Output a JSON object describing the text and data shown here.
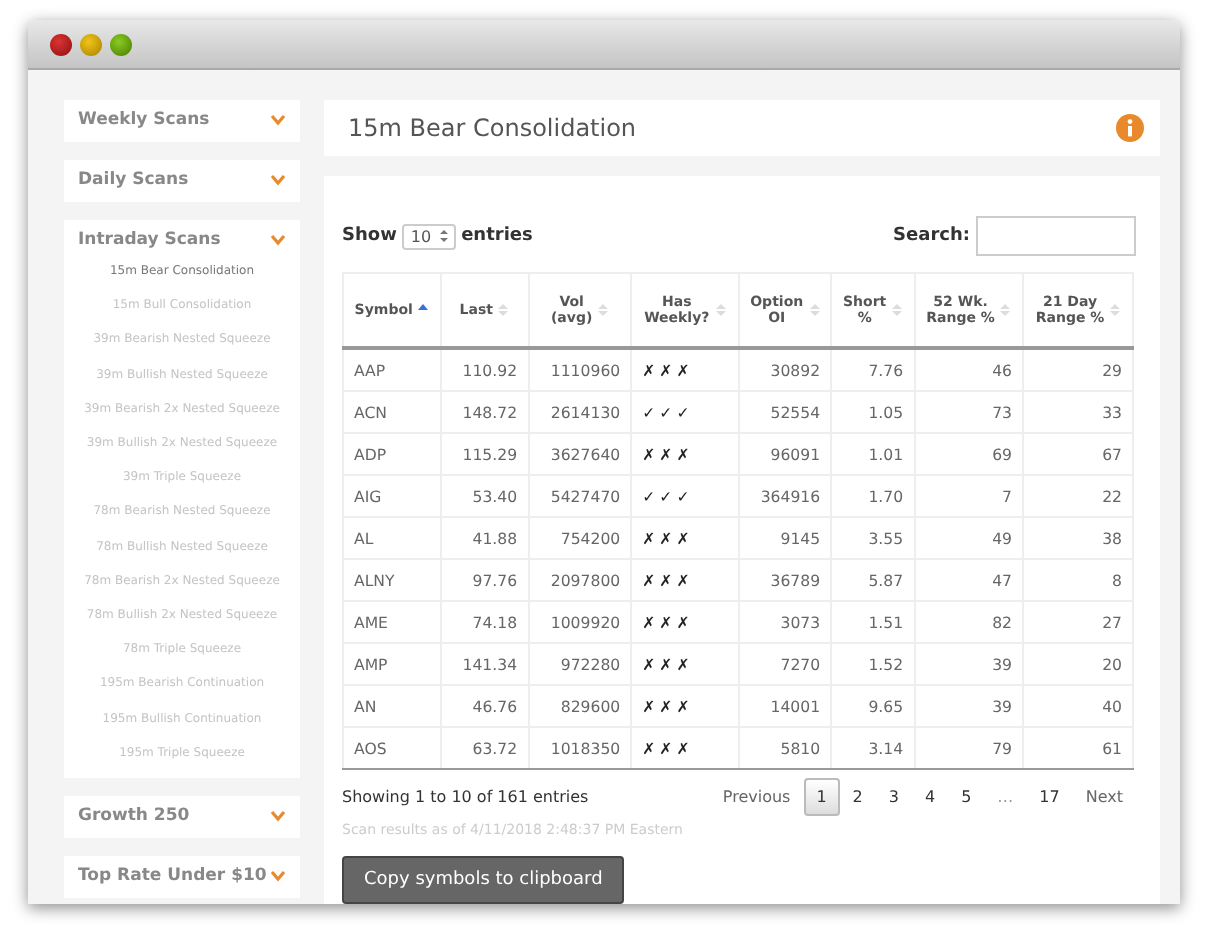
{
  "sidebar": [
    {
      "title": "Weekly Scans"
    },
    {
      "title": "Daily Scans"
    },
    {
      "title": "Intraday Scans",
      "items": [
        {
          "label": "15m Bear Consolidation",
          "selected": true
        },
        {
          "label": "15m Bull Consolidation",
          "selected": false
        },
        {
          "label": "39m Bearish Nested Squeeze",
          "selected": false
        },
        {
          "label": "39m Bullish Nested Squeeze",
          "selected": false
        },
        {
          "label": "39m Bearish 2x Nested Squeeze",
          "selected": false
        },
        {
          "label": "39m Bullish 2x Nested Squeeze",
          "selected": false
        },
        {
          "label": "39m Triple Squeeze",
          "selected": false
        },
        {
          "label": "78m Bearish Nested Squeeze",
          "selected": false
        },
        {
          "label": "78m Bullish Nested Squeeze",
          "selected": false
        },
        {
          "label": "78m Bearish 2x Nested Squeeze",
          "selected": false
        },
        {
          "label": "78m Bullish 2x Nested Squeeze",
          "selected": false
        },
        {
          "label": "78m Triple Squeeze",
          "selected": false
        },
        {
          "label": "195m Bearish Continuation",
          "selected": false
        },
        {
          "label": "195m Bullish Continuation",
          "selected": false
        },
        {
          "label": "195m Triple Squeeze",
          "selected": false
        }
      ]
    },
    {
      "title": "Growth 250"
    },
    {
      "title": "Top Rate Under $10"
    }
  ],
  "header": {
    "title": "15m Bear Consolidation"
  },
  "length_control": {
    "before": "Show",
    "value": "10",
    "after": "entries"
  },
  "search": {
    "label": "Search:"
  },
  "table": {
    "columns": [
      {
        "lines": [
          "Symbol"
        ],
        "sorted": true
      },
      {
        "lines": [
          "Last"
        ],
        "sorted": false
      },
      {
        "lines": [
          "Vol",
          "(avg)"
        ],
        "sorted": false
      },
      {
        "lines": [
          "Has",
          "Weekly?"
        ],
        "sorted": false
      },
      {
        "lines": [
          "Option",
          "OI"
        ],
        "sorted": false
      },
      {
        "lines": [
          "Short",
          "%"
        ],
        "sorted": false
      },
      {
        "lines": [
          "52 Wk.",
          "Range %"
        ],
        "sorted": false
      },
      {
        "lines": [
          "21 Day",
          "Range %"
        ],
        "sorted": false
      }
    ],
    "rows": [
      [
        "AAP",
        "110.92",
        "1110960",
        "✗✗✗",
        "30892",
        "7.76",
        "46",
        "29"
      ],
      [
        "ACN",
        "148.72",
        "2614130",
        "✓✓✓",
        "52554",
        "1.05",
        "73",
        "33"
      ],
      [
        "ADP",
        "115.29",
        "3627640",
        "✗✗✗",
        "96091",
        "1.01",
        "69",
        "67"
      ],
      [
        "AIG",
        "53.40",
        "5427470",
        "✓✓✓",
        "364916",
        "1.70",
        "7",
        "22"
      ],
      [
        "AL",
        "41.88",
        "754200",
        "✗✗✗",
        "9145",
        "3.55",
        "49",
        "38"
      ],
      [
        "ALNY",
        "97.76",
        "2097800",
        "✗✗✗",
        "36789",
        "5.87",
        "47",
        "8"
      ],
      [
        "AME",
        "74.18",
        "1009920",
        "✗✗✗",
        "3073",
        "1.51",
        "82",
        "27"
      ],
      [
        "AMP",
        "141.34",
        "972280",
        "✗✗✗",
        "7270",
        "1.52",
        "39",
        "20"
      ],
      [
        "AN",
        "46.76",
        "829600",
        "✗✗✗",
        "14001",
        "9.65",
        "39",
        "40"
      ],
      [
        "AOS",
        "63.72",
        "1018350",
        "✗✗✗",
        "5810",
        "3.14",
        "79",
        "61"
      ]
    ]
  },
  "info": "Showing 1 to 10 of 161 entries",
  "pagination": [
    {
      "kind": "nav",
      "label": "Previous",
      "selected": false
    },
    {
      "kind": "page",
      "label": "1",
      "selected": true
    },
    {
      "kind": "page",
      "label": "2",
      "selected": false
    },
    {
      "kind": "page",
      "label": "3",
      "selected": false
    },
    {
      "kind": "page",
      "label": "4",
      "selected": false
    },
    {
      "kind": "page",
      "label": "5",
      "selected": false
    },
    {
      "kind": "gap",
      "label": "…",
      "selected": false
    },
    {
      "kind": "page",
      "label": "17",
      "selected": false
    },
    {
      "kind": "nav",
      "label": "Next",
      "selected": false
    }
  ],
  "timestamp": "Scan results as of 4/11/2018 2:48:37 PM Eastern",
  "copy_button": "Copy symbols to clipboard"
}
